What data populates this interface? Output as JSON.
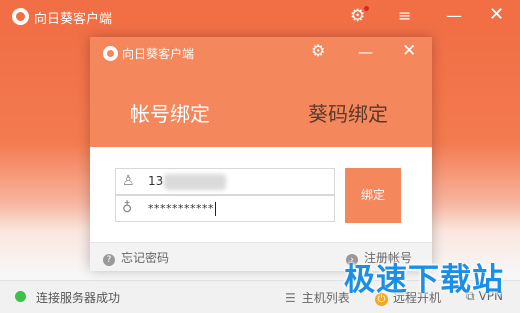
{
  "app": {
    "title": "向日葵客户端"
  },
  "main_window": {
    "status_text": "连接服务器成功",
    "host_list_label": "主机列表",
    "remote_boot_label": "远程开机",
    "vpn_label": "VPN"
  },
  "dialog": {
    "title": "向日葵客户端",
    "tabs": [
      {
        "label": "帐号绑定",
        "active": true
      },
      {
        "label": "葵码绑定",
        "active": false
      }
    ],
    "username_value": "13",
    "password_value": "***********",
    "bind_button": "绑定",
    "forgot_password": "忘记密码",
    "register_account": "注册帐号"
  },
  "watermark": "极速下载站",
  "colors": {
    "brand_orange": "#f26f46",
    "dialog_orange": "#f5875c",
    "status_green": "#3cc24b",
    "watermark_blue": "#1b8ee6"
  },
  "icons": {
    "user": "user-icon",
    "password": "lock-icon",
    "settings": "gear-icon",
    "help": "question-icon",
    "register": "arrow-right-icon"
  }
}
